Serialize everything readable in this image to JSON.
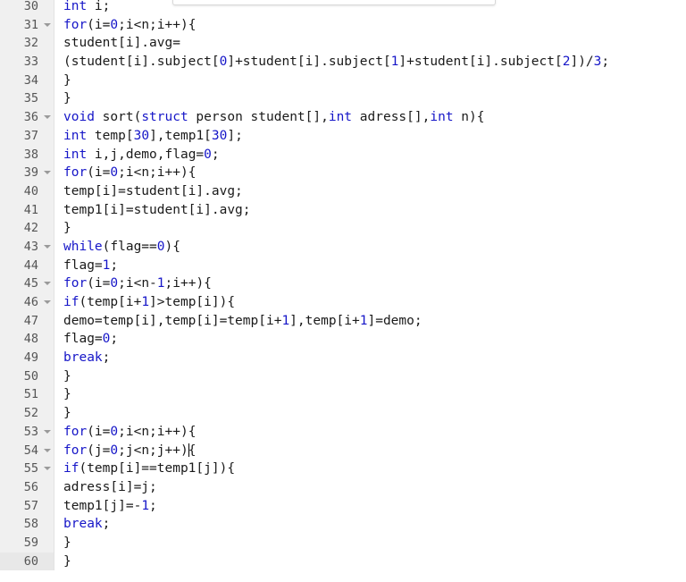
{
  "app": {
    "kind": "code-editor",
    "language": "c",
    "colors": {
      "background": "#ffffff",
      "gutter_background": "#f0f0f0",
      "gutter_text": "#555555",
      "keyword": "#1616c8",
      "number": "#1616c8",
      "plain_text": "#1a1a1a",
      "fold_marker": "#9a9a9a",
      "caret": "#000000",
      "panel_border": "#d8d8d8"
    }
  },
  "top_panel": {
    "label": ""
  },
  "editor": {
    "first_visible_line": 30,
    "last_visible_line": 60,
    "caret_line": 54,
    "lines": [
      {
        "number": "30",
        "fold": false,
        "tokens": [
          {
            "t": "int",
            "c": "kw"
          },
          {
            "t": " i;",
            "c": "pl"
          }
        ]
      },
      {
        "number": "31",
        "fold": true,
        "tokens": [
          {
            "t": "for",
            "c": "kw"
          },
          {
            "t": "(i=",
            "c": "pl"
          },
          {
            "t": "0",
            "c": "num"
          },
          {
            "t": ";i<n;i++){",
            "c": "pl"
          }
        ]
      },
      {
        "number": "32",
        "fold": false,
        "tokens": [
          {
            "t": "student[i].avg=",
            "c": "pl"
          }
        ]
      },
      {
        "number": "33",
        "fold": false,
        "tokens": [
          {
            "t": "(student[i].subject[",
            "c": "pl"
          },
          {
            "t": "0",
            "c": "num"
          },
          {
            "t": "]+student[i].subject[",
            "c": "pl"
          },
          {
            "t": "1",
            "c": "num"
          },
          {
            "t": "]+student[i].subject[",
            "c": "pl"
          },
          {
            "t": "2",
            "c": "num"
          },
          {
            "t": "])/",
            "c": "pl"
          },
          {
            "t": "3",
            "c": "num"
          },
          {
            "t": ";",
            "c": "pl"
          }
        ]
      },
      {
        "number": "34",
        "fold": false,
        "tokens": [
          {
            "t": "}",
            "c": "pl"
          }
        ]
      },
      {
        "number": "35",
        "fold": false,
        "tokens": [
          {
            "t": "}",
            "c": "pl"
          }
        ]
      },
      {
        "number": "36",
        "fold": true,
        "tokens": [
          {
            "t": "void",
            "c": "kw"
          },
          {
            "t": " sort(",
            "c": "pl"
          },
          {
            "t": "struct",
            "c": "kw"
          },
          {
            "t": " person student[],",
            "c": "pl"
          },
          {
            "t": "int",
            "c": "kw"
          },
          {
            "t": " adress[],",
            "c": "pl"
          },
          {
            "t": "int",
            "c": "kw"
          },
          {
            "t": " n){",
            "c": "pl"
          }
        ]
      },
      {
        "number": "37",
        "fold": false,
        "tokens": [
          {
            "t": "int",
            "c": "kw"
          },
          {
            "t": " temp[",
            "c": "pl"
          },
          {
            "t": "30",
            "c": "num"
          },
          {
            "t": "],temp1[",
            "c": "pl"
          },
          {
            "t": "30",
            "c": "num"
          },
          {
            "t": "];",
            "c": "pl"
          }
        ]
      },
      {
        "number": "38",
        "fold": false,
        "tokens": [
          {
            "t": "int",
            "c": "kw"
          },
          {
            "t": " i,j,demo,flag=",
            "c": "pl"
          },
          {
            "t": "0",
            "c": "num"
          },
          {
            "t": ";",
            "c": "pl"
          }
        ]
      },
      {
        "number": "39",
        "fold": true,
        "tokens": [
          {
            "t": "for",
            "c": "kw"
          },
          {
            "t": "(i=",
            "c": "pl"
          },
          {
            "t": "0",
            "c": "num"
          },
          {
            "t": ";i<n;i++){",
            "c": "pl"
          }
        ]
      },
      {
        "number": "40",
        "fold": false,
        "tokens": [
          {
            "t": "temp[i]=student[i].avg;",
            "c": "pl"
          }
        ]
      },
      {
        "number": "41",
        "fold": false,
        "tokens": [
          {
            "t": "temp1[i]=student[i].avg;",
            "c": "pl"
          }
        ]
      },
      {
        "number": "42",
        "fold": false,
        "tokens": [
          {
            "t": "}",
            "c": "pl"
          }
        ]
      },
      {
        "number": "43",
        "fold": true,
        "tokens": [
          {
            "t": "while",
            "c": "kw"
          },
          {
            "t": "(flag==",
            "c": "pl"
          },
          {
            "t": "0",
            "c": "num"
          },
          {
            "t": "){",
            "c": "pl"
          }
        ]
      },
      {
        "number": "44",
        "fold": false,
        "tokens": [
          {
            "t": "flag=",
            "c": "pl"
          },
          {
            "t": "1",
            "c": "num"
          },
          {
            "t": ";",
            "c": "pl"
          }
        ]
      },
      {
        "number": "45",
        "fold": true,
        "tokens": [
          {
            "t": "for",
            "c": "kw"
          },
          {
            "t": "(i=",
            "c": "pl"
          },
          {
            "t": "0",
            "c": "num"
          },
          {
            "t": ";i<n-",
            "c": "pl"
          },
          {
            "t": "1",
            "c": "num"
          },
          {
            "t": ";i++){",
            "c": "pl"
          }
        ]
      },
      {
        "number": "46",
        "fold": true,
        "tokens": [
          {
            "t": "if",
            "c": "kw"
          },
          {
            "t": "(temp[i+",
            "c": "pl"
          },
          {
            "t": "1",
            "c": "num"
          },
          {
            "t": "]>temp[i]){",
            "c": "pl"
          }
        ]
      },
      {
        "number": "47",
        "fold": false,
        "tokens": [
          {
            "t": "demo=temp[i],temp[i]=temp[i+",
            "c": "pl"
          },
          {
            "t": "1",
            "c": "num"
          },
          {
            "t": "],temp[i+",
            "c": "pl"
          },
          {
            "t": "1",
            "c": "num"
          },
          {
            "t": "]=demo;",
            "c": "pl"
          }
        ]
      },
      {
        "number": "48",
        "fold": false,
        "tokens": [
          {
            "t": "flag=",
            "c": "pl"
          },
          {
            "t": "0",
            "c": "num"
          },
          {
            "t": ";",
            "c": "pl"
          }
        ]
      },
      {
        "number": "49",
        "fold": false,
        "tokens": [
          {
            "t": "break",
            "c": "kw"
          },
          {
            "t": ";",
            "c": "pl"
          }
        ]
      },
      {
        "number": "50",
        "fold": false,
        "tokens": [
          {
            "t": "}",
            "c": "pl"
          }
        ]
      },
      {
        "number": "51",
        "fold": false,
        "tokens": [
          {
            "t": "}",
            "c": "pl"
          }
        ]
      },
      {
        "number": "52",
        "fold": false,
        "tokens": [
          {
            "t": "}",
            "c": "pl"
          }
        ]
      },
      {
        "number": "53",
        "fold": true,
        "tokens": [
          {
            "t": "for",
            "c": "kw"
          },
          {
            "t": "(i=",
            "c": "pl"
          },
          {
            "t": "0",
            "c": "num"
          },
          {
            "t": ";i<n;i++){",
            "c": "pl"
          }
        ]
      },
      {
        "number": "54",
        "fold": true,
        "caret_after": "for(j=0;j<n;j++)",
        "tokens": [
          {
            "t": "for",
            "c": "kw"
          },
          {
            "t": "(j=",
            "c": "pl"
          },
          {
            "t": "0",
            "c": "num"
          },
          {
            "t": ";j<n;j++)",
            "c": "pl"
          },
          {
            "t": "|CARET|",
            "c": "caret"
          },
          {
            "t": "{",
            "c": "pl"
          }
        ]
      },
      {
        "number": "55",
        "fold": true,
        "tokens": [
          {
            "t": "if",
            "c": "kw"
          },
          {
            "t": "(temp[i]==temp1[j]){",
            "c": "pl"
          }
        ]
      },
      {
        "number": "56",
        "fold": false,
        "tokens": [
          {
            "t": "adress[i]=j;",
            "c": "pl"
          }
        ]
      },
      {
        "number": "57",
        "fold": false,
        "tokens": [
          {
            "t": "temp1[j]=-",
            "c": "pl"
          },
          {
            "t": "1",
            "c": "num"
          },
          {
            "t": ";",
            "c": "pl"
          }
        ]
      },
      {
        "number": "58",
        "fold": false,
        "tokens": [
          {
            "t": "break",
            "c": "kw"
          },
          {
            "t": ";",
            "c": "pl"
          }
        ]
      },
      {
        "number": "59",
        "fold": false,
        "tokens": [
          {
            "t": "}",
            "c": "pl"
          }
        ]
      },
      {
        "number": "60",
        "fold": false,
        "tokens": [
          {
            "t": "}",
            "c": "pl"
          }
        ]
      }
    ]
  }
}
